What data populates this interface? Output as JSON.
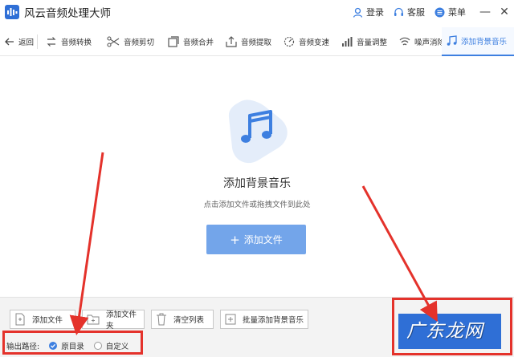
{
  "app": {
    "title": "风云音频处理大师",
    "login": "登录",
    "service": "客服",
    "menu": "菜单",
    "minimize": "—",
    "close": "✕"
  },
  "toolbar": {
    "back": "返回",
    "items": [
      {
        "label": "音频转换",
        "icon": "convert-icon"
      },
      {
        "label": "音频剪切",
        "icon": "scissors-icon"
      },
      {
        "label": "音频合并",
        "icon": "merge-icon"
      },
      {
        "label": "音频提取",
        "icon": "extract-icon"
      },
      {
        "label": "音频变速",
        "icon": "speed-icon"
      },
      {
        "label": "音量调整",
        "icon": "volume-bars-icon"
      },
      {
        "label": "噪声消除",
        "icon": "noise-icon"
      }
    ],
    "active": {
      "label": "添加背景音乐",
      "icon": "music-note-icon"
    }
  },
  "main": {
    "title": "添加背景音乐",
    "hint": "点击添加文件或拖拽文件到此处",
    "add_file_button": "添加文件",
    "plus": "+"
  },
  "bottom": {
    "buttons": [
      "添加文件",
      "添加文件夹",
      "清空列表",
      "批量添加背景音乐"
    ],
    "output_label": "输出路径:",
    "options": [
      {
        "label": "原目录",
        "checked": true
      },
      {
        "label": "自定义",
        "checked": false
      }
    ]
  },
  "watermark": "广东龙网",
  "colors": {
    "accent": "#3d7fe0",
    "button_light": "#73a5ea",
    "start_button": "#2f6fd6",
    "annotation": "#e4322b"
  }
}
